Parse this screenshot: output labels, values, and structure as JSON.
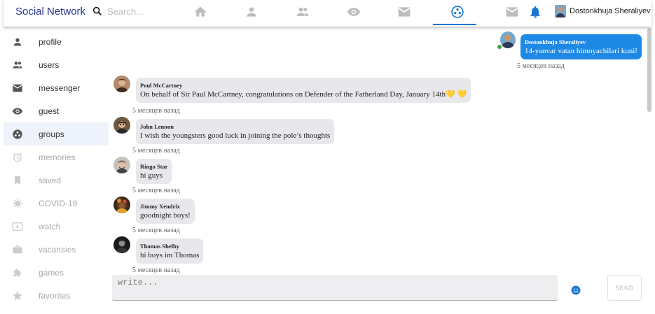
{
  "app": {
    "brand": "Social Network"
  },
  "search": {
    "placeholder": "Search..."
  },
  "header": {
    "nav_icons": [
      "home-icon",
      "person-icon",
      "people-icon",
      "eye-icon",
      "mail-icon",
      "groups-icon"
    ],
    "active_nav": "groups-icon",
    "user_name": "Dostonkhuja Sheraliyev",
    "accent_color": "#1976d2"
  },
  "sidebar": {
    "items": [
      {
        "label": "profile",
        "icon": "person-icon",
        "active": false,
        "dim": false
      },
      {
        "label": "users",
        "icon": "people-icon",
        "active": false,
        "dim": false
      },
      {
        "label": "messenger",
        "icon": "mail-icon",
        "active": false,
        "dim": false
      },
      {
        "label": "guest",
        "icon": "eye-icon",
        "active": false,
        "dim": false
      },
      {
        "label": "groups",
        "icon": "groups-icon",
        "active": true,
        "dim": false
      },
      {
        "label": "memories",
        "icon": "alarm-icon",
        "active": false,
        "dim": true
      },
      {
        "label": "saved",
        "icon": "bookmark-icon",
        "active": false,
        "dim": true
      },
      {
        "label": "COVID-19",
        "icon": "virus-icon",
        "active": false,
        "dim": true
      },
      {
        "label": "watch",
        "icon": "video-icon",
        "active": false,
        "dim": true
      },
      {
        "label": "vacansies",
        "icon": "briefcase-icon",
        "active": false,
        "dim": true
      },
      {
        "label": "games",
        "icon": "puzzle-icon",
        "active": false,
        "dim": true
      },
      {
        "label": "favorites",
        "icon": "star-icon",
        "active": false,
        "dim": true
      }
    ]
  },
  "own_message": {
    "name": "Dostonkhuja Sheraliyev",
    "text": "14-yanvar vatan himoyachilari kuni!",
    "time": "5 месяцев назад",
    "bubble_color": "#1e88e5"
  },
  "messages": [
    {
      "name": "Poul McCartney",
      "text": "On behalf of Sir Paul McCartney, congratulations on Defender of the Fatherland Day, January 14th",
      "emoji": "💛 💛",
      "time": "5 месяцев назад"
    },
    {
      "name": "John Lennon",
      "text": "I wish the youngsters good luck in joining the pole’s thoughts",
      "emoji": "",
      "time": "5 месяцев назад"
    },
    {
      "name": "Ringo Star",
      "text": "hi guys",
      "emoji": "",
      "time": "5 месяцев назад"
    },
    {
      "name": "Jimmy Xendrix",
      "text": "goodnight boys!",
      "emoji": "",
      "time": "5 месяцев назад"
    },
    {
      "name": "Thomas Shelby",
      "text": "hi boys im Thomas",
      "emoji": "",
      "time": "5 месяцев назад"
    }
  ],
  "composer": {
    "placeholder": "write...",
    "send_label": "SEND"
  }
}
